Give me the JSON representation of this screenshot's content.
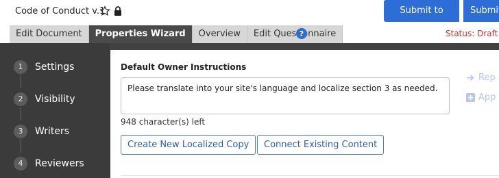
{
  "header": {
    "doc_title": "Code of Conduct v.1",
    "submit_writers": "Submit to Writers",
    "submit_more": "Submit"
  },
  "tabs": [
    {
      "label": "Edit Document",
      "active": false
    },
    {
      "label": "Properties Wizard",
      "active": true
    },
    {
      "label": "Overview",
      "active": false
    },
    {
      "label": "Edit Questionnaire",
      "active": false
    }
  ],
  "status": "Status: Draft",
  "steps": [
    {
      "num": "1",
      "label": "Settings"
    },
    {
      "num": "2",
      "label": "Visibility"
    },
    {
      "num": "3",
      "label": "Writers"
    },
    {
      "num": "4",
      "label": "Reviewers"
    }
  ],
  "main": {
    "section_title": "Default Owner Instructions",
    "instructions_value": "Please translate into your site's language and localize section 3 as needed.",
    "char_count": "948 character(s) left",
    "create_button": "Create New Localized Copy",
    "connect_button": "Connect Existing Content"
  },
  "side_actions": [
    "Rep",
    "App"
  ],
  "colors": {
    "accent": "#2d6ed6",
    "sidebar": "#3b3b3b",
    "status": "#cc3333"
  }
}
